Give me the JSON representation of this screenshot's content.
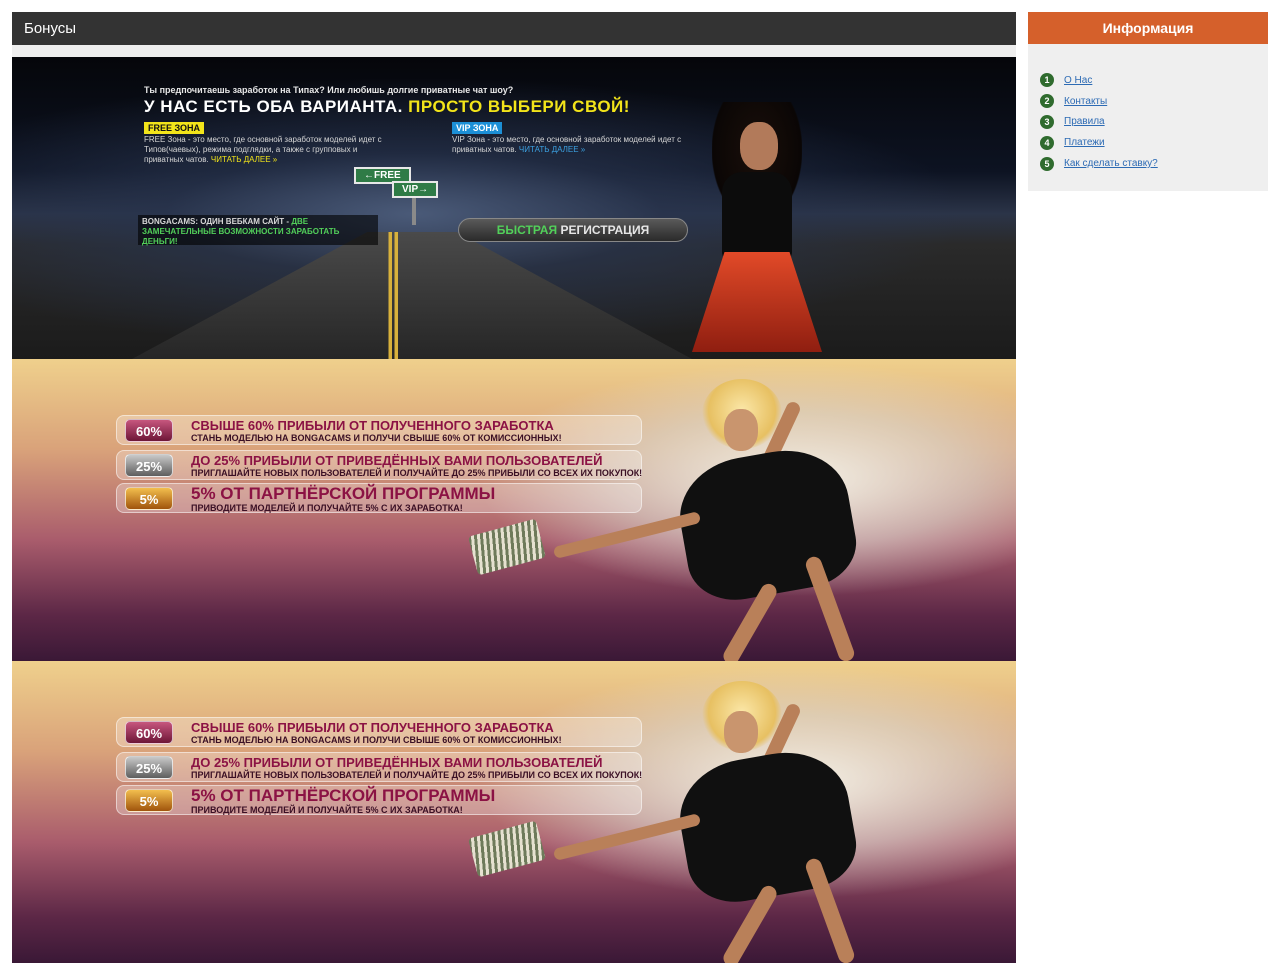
{
  "page": {
    "title": "Бонусы"
  },
  "banner_road": {
    "question": "Ты предпочитаешь заработок на Типах? Или любишь долгие приватные чат шоу?",
    "headline_white": "У НАС ЕСТЬ ОБА ВАРИАНТА.",
    "headline_yellow": "ПРОСТО ВЫБЕРИ СВОЙ!",
    "free_zone_tag": "FREE ЗОНА",
    "free_zone_text": "FREE Зона - это место, где основной заработок моделей идет с Типов(чаевых), режима подглядки, а также с групповых и приватных чатов.",
    "free_zone_more": "ЧИТАТЬ ДАЛЕЕ »",
    "vip_zone_tag": "VIP ЗОНА",
    "vip_zone_text": "VIP Зона - это место, где основной заработок моделей идет с приватных чатов.",
    "vip_zone_more": "ЧИТАТЬ ДАЛЕЕ »",
    "sign_free": "←FREE",
    "sign_vip": "VIP→",
    "bonga_white": "BONGACAMS: ОДИН ВЕБКАМ САЙТ -",
    "bonga_green": "ДВЕ ЗАМЕЧАТЕЛЬНЫЕ ВОЗМОЖНОСТИ ЗАРАБОТАТЬ ДЕНЬГИ!",
    "reg_green": "БЫСТРАЯ",
    "reg_white": "РЕГИСТРАЦИЯ"
  },
  "promo": {
    "rows": [
      {
        "badge": "60%",
        "title": "СВЫШЕ 60% ПРИБЫЛИ ОТ ПОЛУЧЕННОГО ЗАРАБОТКА",
        "subtitle": "СТАНЬ МОДЕЛЬЮ НА BONGACAMS И ПОЛУЧИ СВЫШЕ 60% ОТ КОМИССИОННЫХ!"
      },
      {
        "badge": "25%",
        "title": "ДО 25% ПРИБЫЛИ ОТ ПРИВЕДЁННЫХ ВАМИ ПОЛЬЗОВАТЕЛЕЙ",
        "subtitle": "ПРИГЛАШАЙТЕ НОВЫХ ПОЛЬЗОВАТЕЛЕЙ И ПОЛУЧАЙТЕ ДО 25% ПРИБЫЛИ СО ВСЕХ ИХ ПОКУПОК!"
      },
      {
        "badge": "5%",
        "title": "5% ОТ ПАРТНЁРСКОЙ ПРОГРАММЫ",
        "subtitle": "ПРИВОДИТЕ МОДЕЛЕЙ И ПОЛУЧАЙТЕ 5% С ИХ ЗАРАБОТКА!"
      }
    ]
  },
  "sidebar": {
    "title": "Информация",
    "items": [
      {
        "num": "1",
        "label": "О Нас"
      },
      {
        "num": "2",
        "label": "Контакты"
      },
      {
        "num": "3",
        "label": "Правила"
      },
      {
        "num": "4",
        "label": "Платежи"
      },
      {
        "num": "5",
        "label": "Как сделать ставку?"
      }
    ]
  },
  "colors": {
    "header_bg": "#333333",
    "sidebar_head_bg": "#d5602b",
    "number_badge_bg": "#2f6b2e",
    "link": "#2d6bb4"
  }
}
